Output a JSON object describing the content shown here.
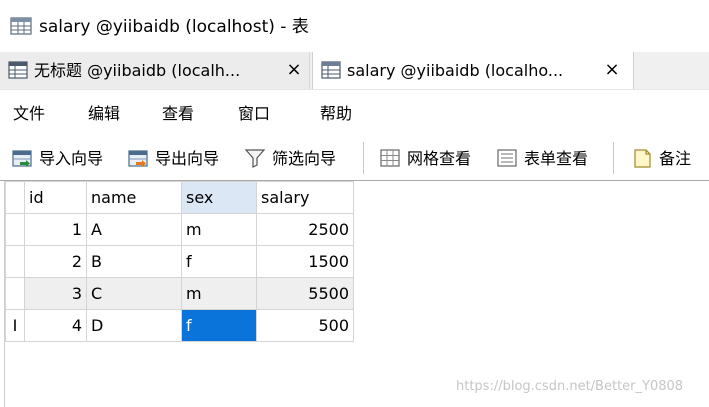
{
  "window": {
    "title": "salary @yiibaidb (localhost) - 表"
  },
  "tabs": [
    {
      "label": "无标题 @yiibaidb (localh...",
      "close": "×",
      "active": false
    },
    {
      "label": "salary @yiibaidb (localho...",
      "close": "×",
      "active": true
    }
  ],
  "menu": [
    "文件",
    "编辑",
    "查看",
    "窗口",
    "帮助"
  ],
  "toolbar": {
    "import_wizard": "导入向导",
    "export_wizard": "导出向导",
    "filter_wizard": "筛选向导",
    "grid_view": "网格查看",
    "form_view": "表单查看",
    "memo": "备注"
  },
  "grid": {
    "columns": [
      "id",
      "name",
      "sex",
      "salary"
    ],
    "rows": [
      {
        "id": "1",
        "name": "A",
        "sex": "m",
        "salary": "2500"
      },
      {
        "id": "2",
        "name": "B",
        "sex": "f",
        "salary": "1500"
      },
      {
        "id": "3",
        "name": "C",
        "sex": "m",
        "salary": "5500"
      },
      {
        "id": "4",
        "name": "D",
        "sex": "f",
        "salary": "500"
      }
    ],
    "current_row_indicator": "I",
    "selected_cell": {
      "row": 4,
      "column": "sex"
    }
  },
  "watermark": "https://blog.csdn.net/Better_Y0808",
  "colors": {
    "selection": "#0a74da",
    "sorted_header": "#dbe7f5",
    "alt_row": "#efefef"
  },
  "icons": [
    "table-icon",
    "import-icon",
    "export-icon",
    "filter-icon",
    "grid-icon",
    "form-icon",
    "memo-icon"
  ]
}
